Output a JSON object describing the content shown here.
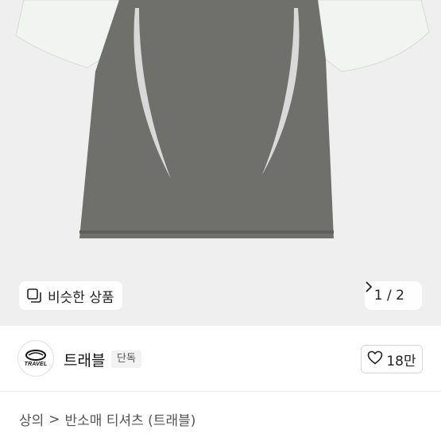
{
  "product_image": {
    "description_icon": "shirt-photo"
  },
  "similar_button": {
    "label": "비슷한 상품",
    "icon": "similar-items-icon"
  },
  "pager": {
    "current": "1",
    "separator": "/",
    "total": "2",
    "next_icon": "chevron-right-icon"
  },
  "shop": {
    "logo_text": "TRAVEL",
    "name": "트래블",
    "badge": "단독"
  },
  "like": {
    "icon": "heart-icon",
    "count": "18만"
  },
  "breadcrumb": {
    "level1": "상의",
    "separator": ">",
    "level2": "반소매 티셔츠 (트래블)"
  }
}
